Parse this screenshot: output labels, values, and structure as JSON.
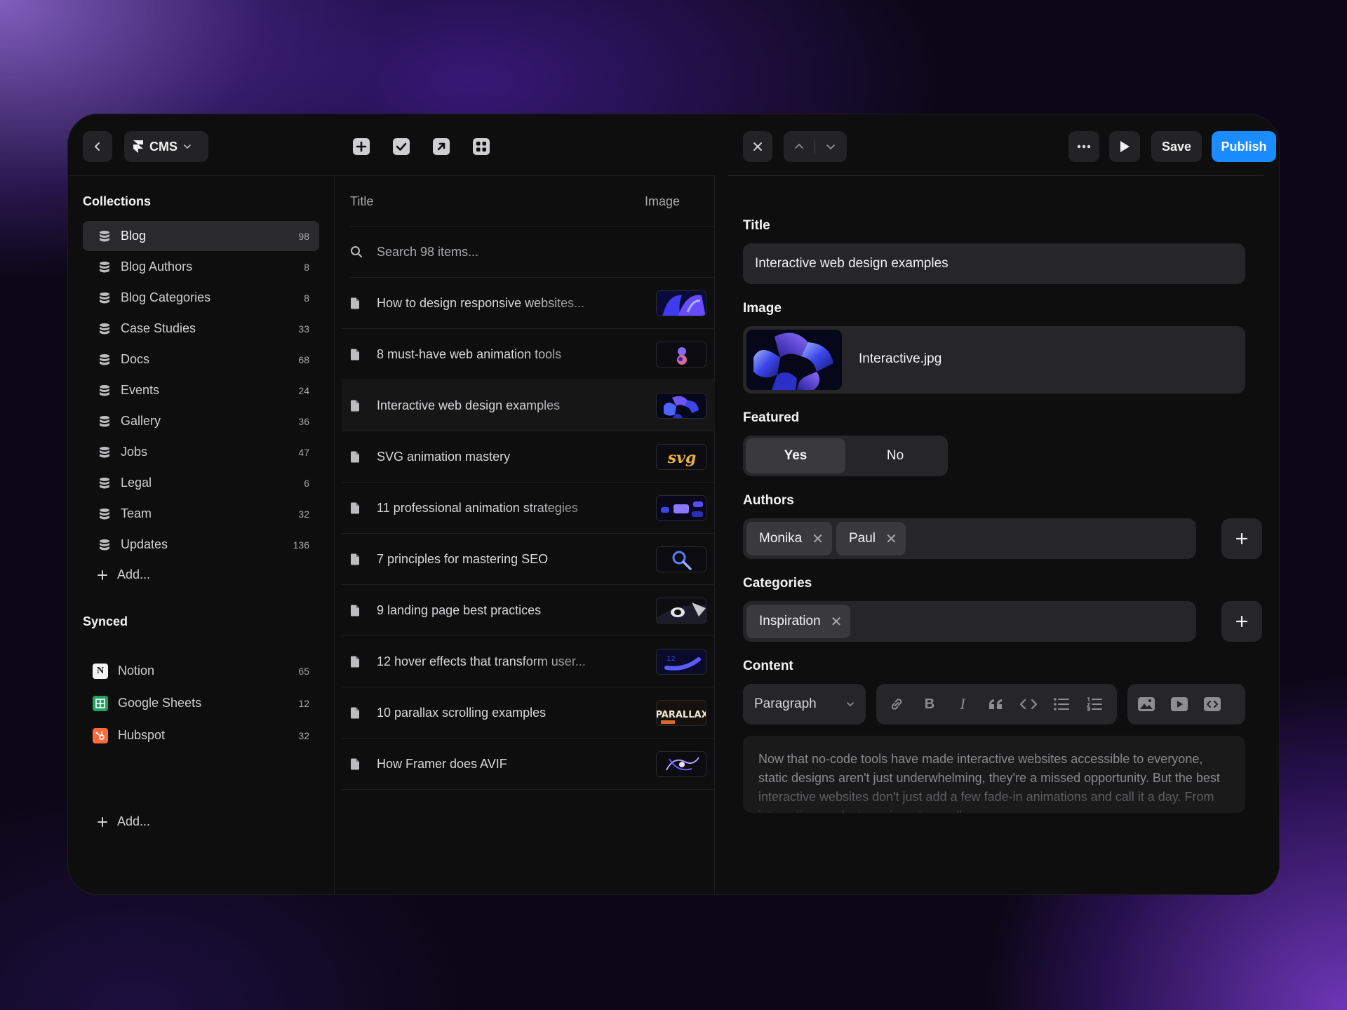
{
  "toolbar": {
    "app_label": "CMS",
    "save_label": "Save",
    "publish_label": "Publish"
  },
  "sidebar": {
    "collections_title": "Collections",
    "collections": [
      {
        "label": "Blog",
        "count": "98",
        "active": true
      },
      {
        "label": "Blog Authors",
        "count": "8"
      },
      {
        "label": "Blog Categories",
        "count": "8"
      },
      {
        "label": "Case Studies",
        "count": "33"
      },
      {
        "label": "Docs",
        "count": "68"
      },
      {
        "label": "Events",
        "count": "24"
      },
      {
        "label": "Gallery",
        "count": "36"
      },
      {
        "label": "Jobs",
        "count": "47"
      },
      {
        "label": "Legal",
        "count": "6"
      },
      {
        "label": "Team",
        "count": "32"
      },
      {
        "label": "Updates",
        "count": "136"
      }
    ],
    "add_label": "Add...",
    "synced_title": "Synced",
    "synced": [
      {
        "label": "Notion",
        "count": "65",
        "icon": "notion-icon"
      },
      {
        "label": "Google Sheets",
        "count": "12",
        "icon": "google-sheets-icon"
      },
      {
        "label": "Hubspot",
        "count": "32",
        "icon": "hubspot-icon"
      }
    ],
    "synced_add_label": "Add..."
  },
  "list": {
    "col_title": "Title",
    "col_image": "Image",
    "search_placeholder": "Search 98 items...",
    "items": [
      {
        "title": "How to design responsive websites..."
      },
      {
        "title": "8 must-have web animation tools"
      },
      {
        "title": "Interactive web design examples",
        "selected": true
      },
      {
        "title": "SVG animation mastery"
      },
      {
        "title": "11 professional animation strategies"
      },
      {
        "title": "7 principles for mastering SEO"
      },
      {
        "title": "9 landing page best practices"
      },
      {
        "title": "12 hover effects that transform user..."
      },
      {
        "title": "10 parallax scrolling examples"
      },
      {
        "title": "How Framer does AVIF"
      }
    ]
  },
  "editor": {
    "title_label": "Title",
    "title_value": "Interactive web design examples",
    "image_label": "Image",
    "image_filename": "Interactive.jpg",
    "featured_label": "Featured",
    "featured_yes": "Yes",
    "featured_no": "No",
    "authors_label": "Authors",
    "authors": [
      "Monika",
      "Paul"
    ],
    "categories_label": "Categories",
    "categories": [
      "Inspiration"
    ],
    "content_label": "Content",
    "paragraph_select": "Paragraph",
    "content_text": "Now that no-code tools have made interactive websites accessible to everyone, static designs aren't just underwhelming, they're a missed opportunity. But the best interactive websites don't just add a few fade-in animations and call it a day. From interactive product previews to scroll-"
  },
  "colors": {
    "accent": "#1a8cff",
    "panel": "#0e0e0e",
    "field": "#262628"
  }
}
